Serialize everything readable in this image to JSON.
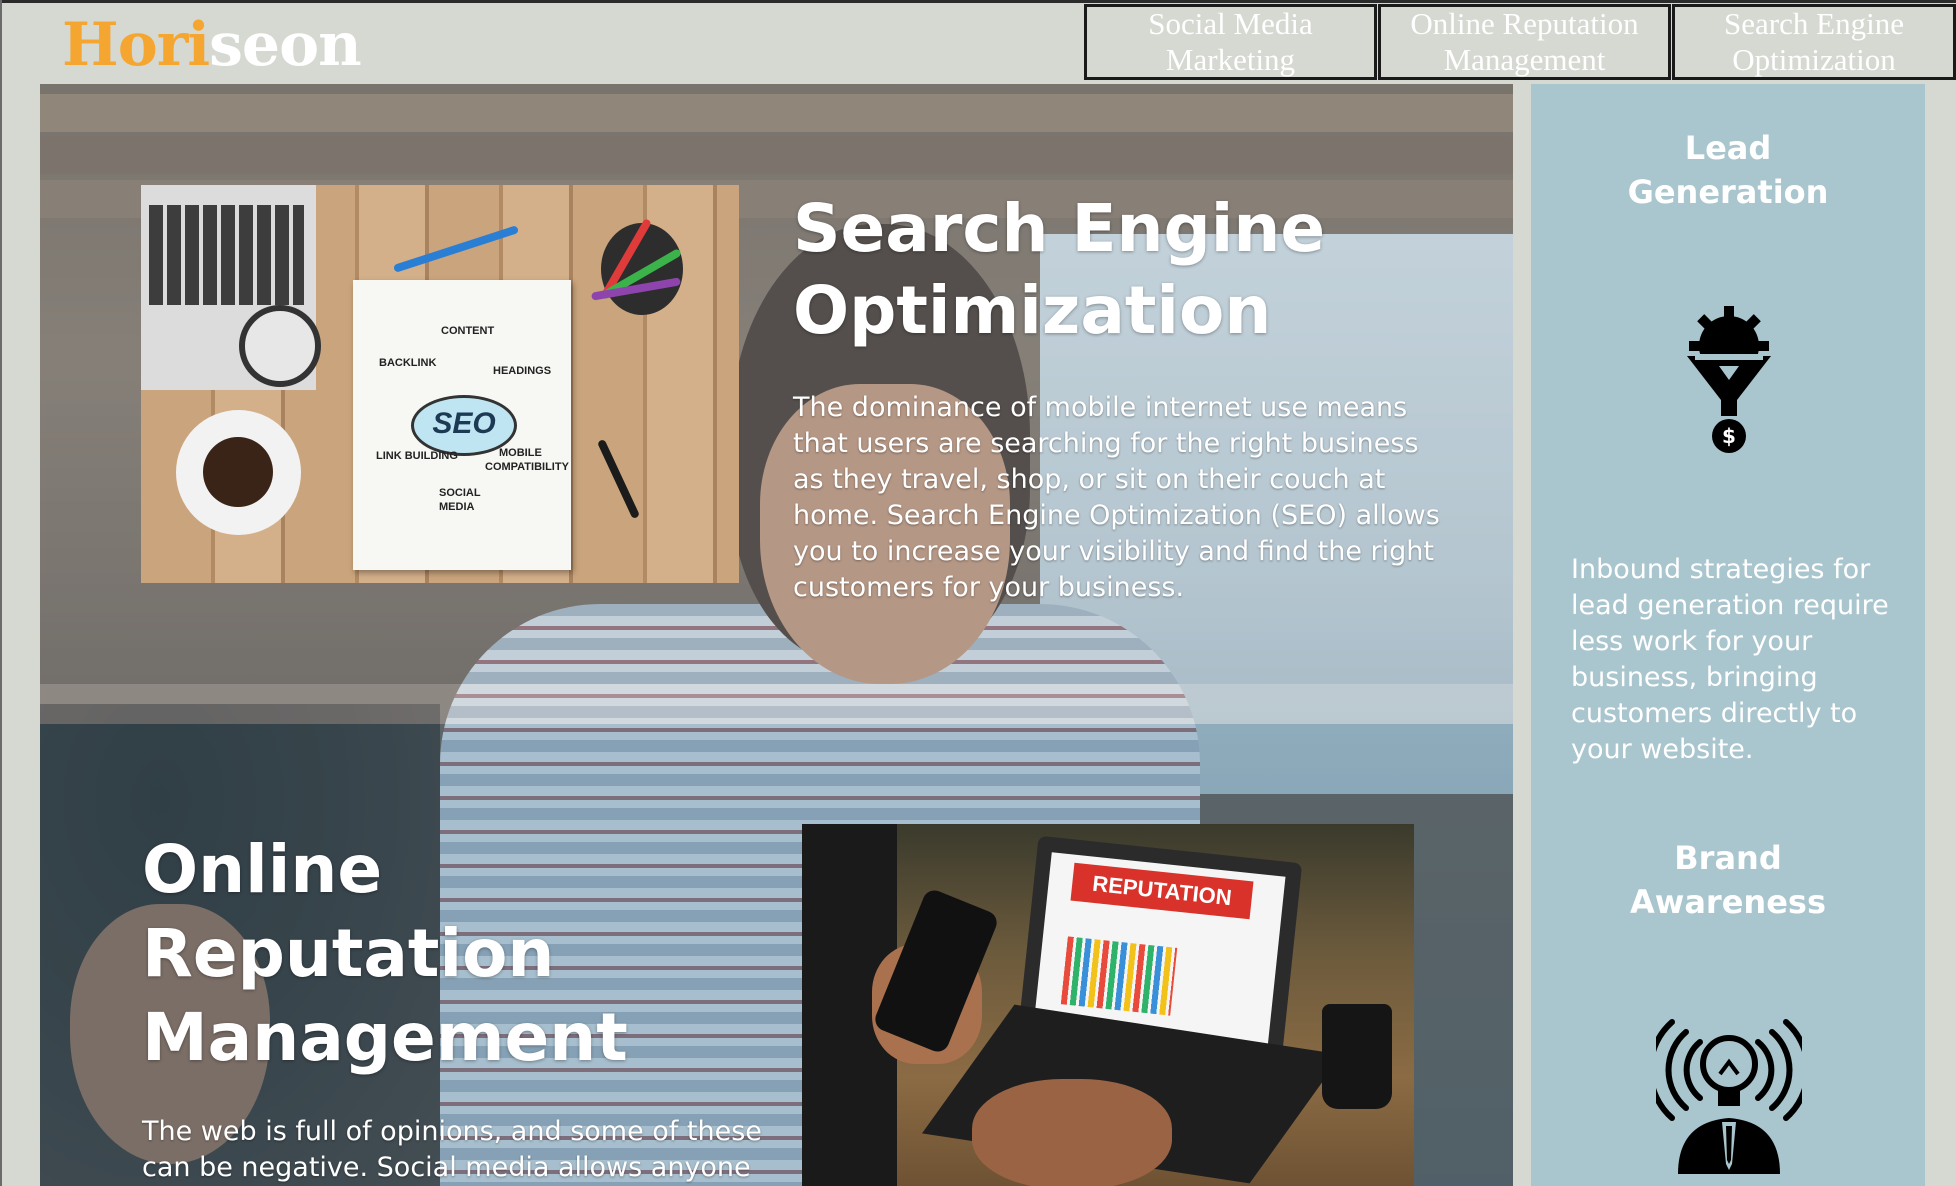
{
  "header": {
    "logo_part1": "Hori",
    "logo_part2": "seon",
    "nav": [
      {
        "line1": "Social Media",
        "line2": "Marketing"
      },
      {
        "line1": "Online Reputation",
        "line2": "Management"
      },
      {
        "line1": "Search Engine",
        "line2": "Optimization"
      }
    ]
  },
  "content": {
    "seo": {
      "title_line1": "Search Engine",
      "title_line2": "Optimization",
      "paragraph_lines": [
        "The dominance of mobile internet use means",
        "that users are searching for the right business",
        "as they travel, shop, or sit on their couch at",
        "home. Search Engine Optimization (SEO) allows",
        "you to increase your visibility and find the right",
        "customers for your business."
      ],
      "image_labels": {
        "content": "CONTENT",
        "backlink": "BACKLINK",
        "headings": "HEADINGS",
        "seo": "SEO",
        "link_building": "LINK BUILDING",
        "mobile": "MOBILE",
        "compatibility": "COMPATIBILITY",
        "social": "SOCIAL",
        "media": "MEDIA"
      }
    },
    "orm": {
      "title_line1": "Online",
      "title_line2": "Reputation",
      "title_line3": "Management",
      "paragraph_lines": [
        "The web is full of opinions, and some of these",
        "can be negative. Social media allows anyone"
      ],
      "image_banner": "REPUTATION"
    }
  },
  "aside": {
    "lead": {
      "title_line1": "Lead",
      "title_line2": "Generation",
      "icon": "lead-generation-icon",
      "text_lines": [
        "Inbound strategies for",
        "lead generation require",
        "less work for your",
        "business, bringing",
        "customers directly to",
        "your website."
      ]
    },
    "brand": {
      "title_line1": "Brand",
      "title_line2": "Awareness",
      "icon": "brand-awareness-icon"
    }
  },
  "colors": {
    "logo_orange": "#f5a630",
    "logo_white": "#ffffff",
    "page_bg": "#d6d8d2",
    "aside_bg": "#a9c5cd"
  }
}
